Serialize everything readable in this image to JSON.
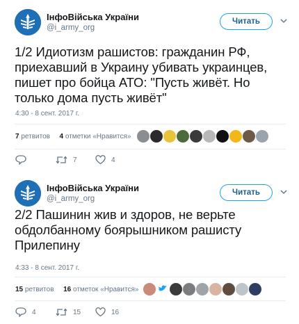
{
  "tweets": [
    {
      "author": {
        "name": "ІнфоВійська України",
        "handle": "@i_army_org"
      },
      "follow_label": "Читать",
      "text": "1/2 Идиотизм рашистов: гражданин РФ, приехавший в Украину убивать украинцев, пишет про бойца АТО: \"Пусть живёт. Но только дома пусть живёт\"",
      "time": "4:30 - 8 сент. 2017 г.",
      "retweets_count": "7",
      "retweets_label": "ретвитов",
      "likes_count": "4",
      "likes_label": "отметки «Нравится»",
      "actions": {
        "reply": "",
        "retweet": "7",
        "like": "4"
      }
    },
    {
      "author": {
        "name": "ІнфоВійська України",
        "handle": "@i_army_org"
      },
      "follow_label": "Читать",
      "text": "2/2 Пашинин жив и здоров, не верьте обдолбанному боярышником рашисту Прилепину",
      "time": "4:33 - 8 сент. 2017 г.",
      "retweets_count": "15",
      "retweets_label": "ретвитов",
      "likes_count": "16",
      "likes_label": "отметок «Нравится»",
      "actions": {
        "reply": "4",
        "retweet": "15",
        "like": "16"
      }
    }
  ],
  "colors": {
    "accent": "#1da1f2",
    "follow_text": "#1b5f91",
    "avatar_bg": "#1f6fb6",
    "muted": "#657786"
  }
}
